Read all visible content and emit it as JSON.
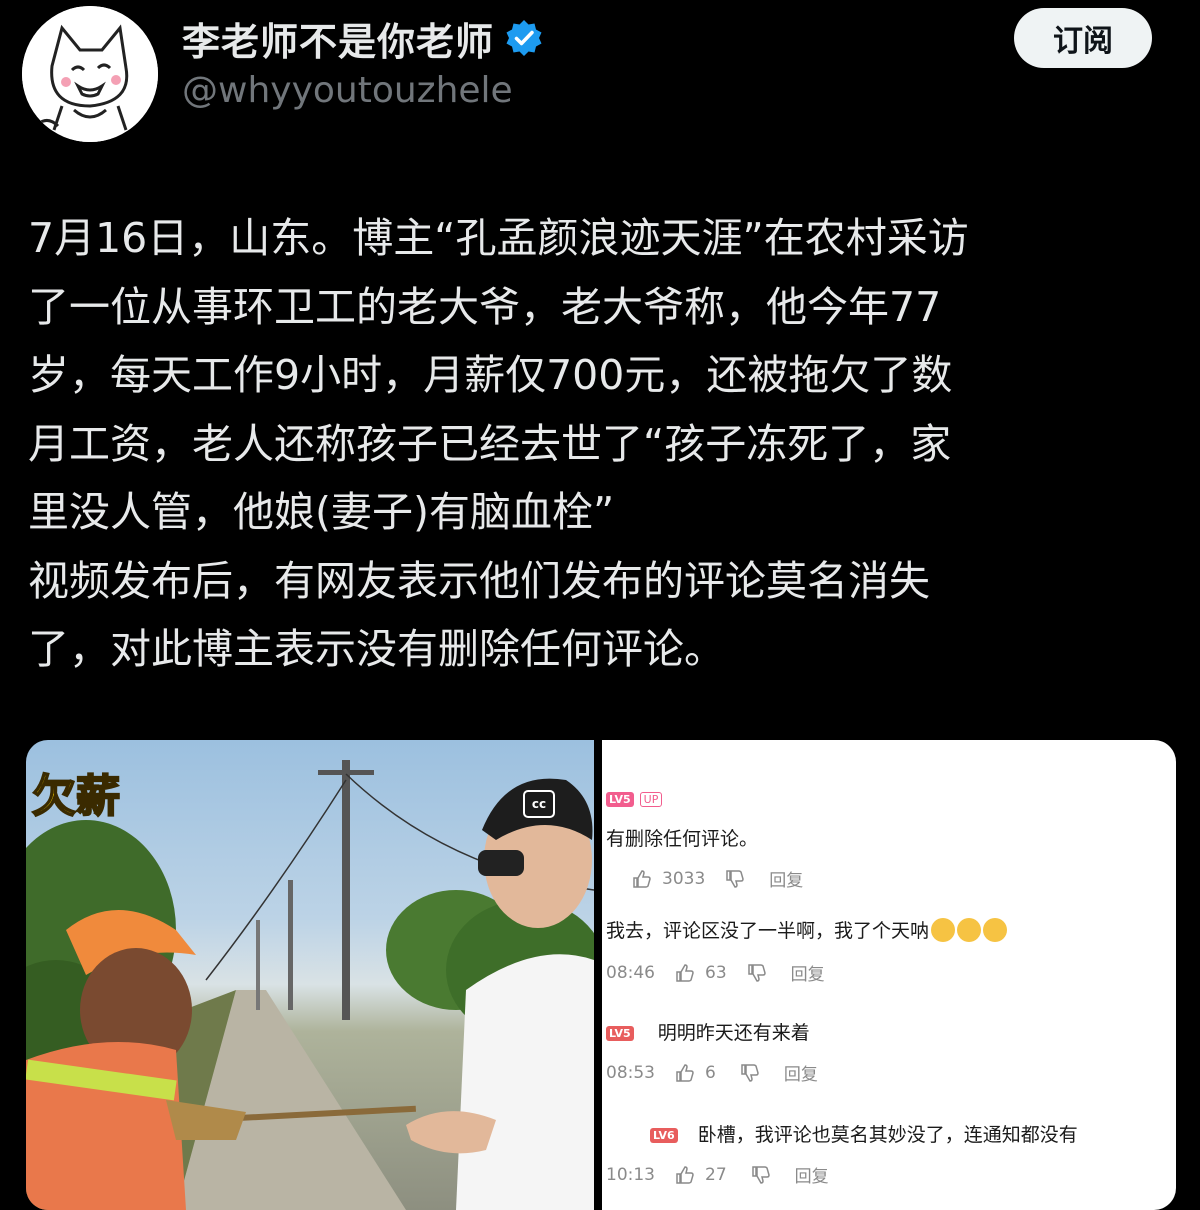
{
  "header": {
    "display_name": "李老师不是你老师",
    "handle": "@whyyoutouzhele",
    "subscribe_label": "订阅",
    "verified_color": "#1d9bf0"
  },
  "post": {
    "lines": [
      "7月16日，山东。博主“孔孟颜浪迹天涯”在农村采访",
      "了一位从事环卫工的老大爷，老大爷称，他今年77",
      "岁，每天工作9小时，月薪仅700元，还被拖欠了数",
      "月工资，老人还称孩子已经去世了“孩子冻死了，家",
      "里没人管，他娘(妻子)有脑血栓”",
      "视频发布后，有网友表示他们发布的评论莫名消失",
      "了，对此博主表示没有删除任何评论。"
    ]
  },
  "media": {
    "left_photo": {
      "overlay_text": "欠薪",
      "cc_badge": "cc"
    },
    "comments": {
      "c1": {
        "level": "LV5",
        "tag": "UP",
        "text": "有删除任何评论。",
        "likes": "3033",
        "reply": "回复"
      },
      "c2": {
        "text": "我去，评论区没了一半啊，我了个天呐",
        "time": "08:46",
        "likes": "63",
        "reply": "回复"
      },
      "c3": {
        "level": "LV5",
        "text": "明明昨天还有来着",
        "time": "08:53",
        "likes": "6",
        "reply": "回复"
      },
      "c4": {
        "level": "LV6",
        "text": "卧槽，我评论也莫名其妙没了，连通知都没有",
        "time": "10:13",
        "likes": "27",
        "reply": "回复"
      }
    }
  }
}
